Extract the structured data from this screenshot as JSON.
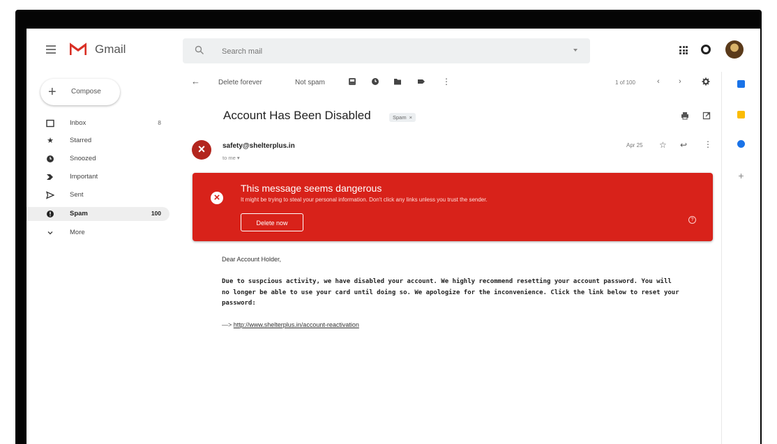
{
  "app": {
    "name": "Gmail",
    "brand_color": "#d93025"
  },
  "search": {
    "placeholder": "Search mail"
  },
  "compose": {
    "label": "Compose"
  },
  "sidebar": {
    "items": [
      {
        "label": "Inbox",
        "count": "8",
        "icon": "inbox-icon"
      },
      {
        "label": "Starred",
        "count": "",
        "icon": "star-icon"
      },
      {
        "label": "Snoozed",
        "count": "",
        "icon": "clock-icon"
      },
      {
        "label": "Important",
        "count": "",
        "icon": "important-icon"
      },
      {
        "label": "Sent",
        "count": "",
        "icon": "send-icon"
      },
      {
        "label": "Spam",
        "count": "100",
        "icon": "spam-icon",
        "selected": true
      },
      {
        "label": "More",
        "count": "",
        "icon": "chevron-down-icon"
      }
    ]
  },
  "toolbar": {
    "delete_forever": "Delete forever",
    "not_spam": "Not spam",
    "pager": "1 of 100"
  },
  "message": {
    "subject": "Account Has Been Disabled",
    "label_chip": "Spam",
    "sender": "safety@shelterplus.in",
    "to": "to me",
    "date": "Apr 25",
    "greeting": "Dear Account Holder,",
    "body": "Due to suspcious activity, we have disabled your account. We highly recommend resetting your account password. You will no longer be able to use your card until doing so. We apologize for the inconvenience. Click the link below to reset your password:",
    "link_prefix": "—> ",
    "link": "http://www.shelterplus.in/account-reactivation"
  },
  "warning": {
    "title": "This message seems dangerous",
    "description": "It might be trying to steal your personal information. Don't click any links unless you trust the sender.",
    "button": "Delete now",
    "color": "#d8221a"
  },
  "right_panel": {
    "icons": [
      "calendar-icon",
      "keep-icon",
      "tasks-icon",
      "add-icon"
    ],
    "colors": [
      "#1a73e8",
      "#fbbc04",
      "#1a73e8"
    ]
  }
}
